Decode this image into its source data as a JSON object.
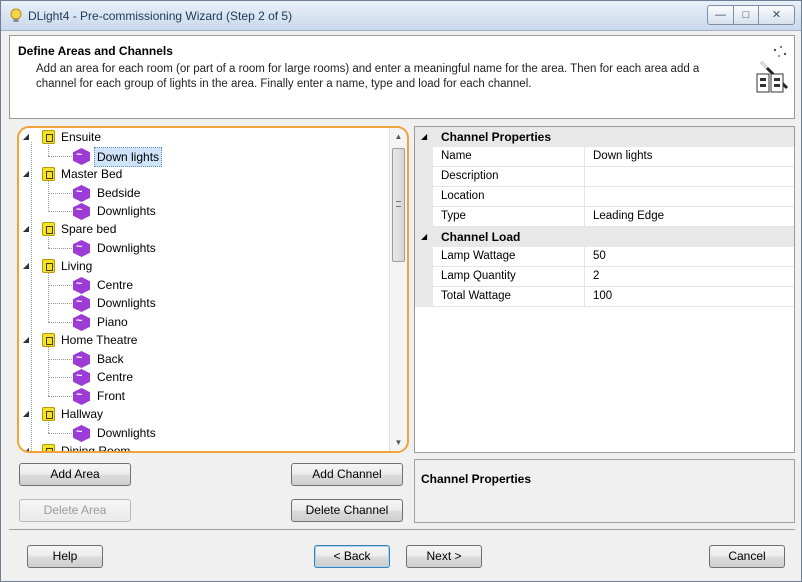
{
  "window": {
    "title": "DLight4 - Pre-commissioning Wizard (Step 2 of 5)",
    "controls": {
      "minimize": "—",
      "maximize": "□",
      "close": "✕"
    }
  },
  "header": {
    "title": "Define Areas and Channels",
    "description": "Add an area for each room (or part of a room for large rooms) and enter a meaningful name for the area. Then for each area add a channel for each group of lights in the area. Finally enter a name, type and load for each channel."
  },
  "tree": {
    "areas": [
      {
        "label": "Ensuite",
        "channels": [
          "Down lights"
        ]
      },
      {
        "label": "Master Bed",
        "channels": [
          "Bedside",
          "Downlights"
        ]
      },
      {
        "label": "Spare bed",
        "channels": [
          "Downlights"
        ]
      },
      {
        "label": "Living",
        "channels": [
          "Centre",
          "Downlights",
          "Piano"
        ]
      },
      {
        "label": "Home Theatre",
        "channels": [
          "Back",
          "Centre",
          "Front"
        ]
      },
      {
        "label": "Hallway",
        "channels": [
          "Downlights"
        ]
      },
      {
        "label": "Dining Room",
        "channels": []
      }
    ],
    "selected": "Down lights"
  },
  "properties": {
    "categories": [
      {
        "label": "Channel Properties",
        "rows": [
          {
            "key": "Name",
            "value": "Down lights"
          },
          {
            "key": "Description",
            "value": ""
          },
          {
            "key": "Location",
            "value": ""
          },
          {
            "key": "Type",
            "value": "Leading Edge"
          }
        ]
      },
      {
        "label": "Channel Load",
        "rows": [
          {
            "key": "Lamp Wattage",
            "value": "50"
          },
          {
            "key": "Lamp Quantity",
            "value": "2"
          },
          {
            "key": "Total Wattage",
            "value": "100"
          }
        ]
      }
    ],
    "description_title": "Channel Properties"
  },
  "buttons": {
    "add_area": "Add Area",
    "delete_area": "Delete Area",
    "add_channel": "Add Channel",
    "delete_channel": "Delete Channel",
    "help": "Help",
    "back": "< Back",
    "next": "Next >",
    "cancel": "Cancel"
  },
  "icons": {
    "app": "lightbulb-icon",
    "wizard": "magic-wand-icon",
    "area": "area-icon",
    "channel": "channel-icon"
  },
  "colors": {
    "tree_highlight_border": "#f2a23a",
    "area_icon": "#f3e22a",
    "channel_icon": "#9d3bd6",
    "selection": "#cfe3f9"
  }
}
